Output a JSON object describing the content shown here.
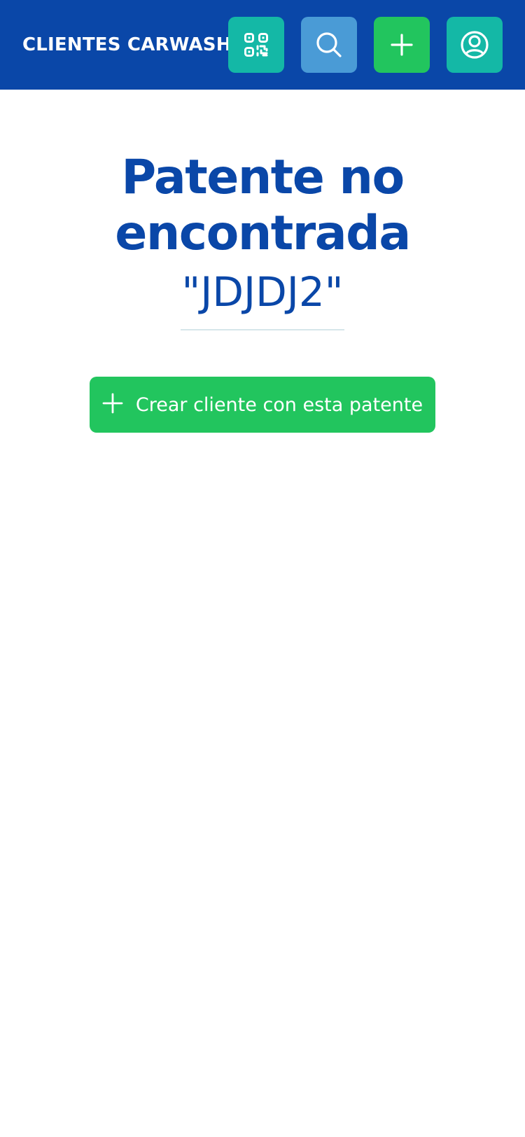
{
  "header": {
    "title": "CLIENTES CARWASH",
    "buttons": [
      {
        "icon": "qr-code-icon",
        "color": "#14b8a6"
      },
      {
        "icon": "search-icon",
        "color": "#4a9bd6"
      },
      {
        "icon": "plus-icon",
        "color": "#22c55e"
      },
      {
        "icon": "user-circle-icon",
        "color": "#14b8a6"
      }
    ],
    "background": "#0a47a8"
  },
  "main": {
    "title": "Patente no encontrada",
    "plate": "\"JDJDJ2\"",
    "create_button": {
      "label": "Crear cliente con esta patente",
      "icon": "plus-icon",
      "color": "#22c55e"
    }
  },
  "colors": {
    "primary": "#0a47a8",
    "accent_green": "#22c55e",
    "accent_teal": "#14b8a6",
    "accent_blue": "#4a9bd6"
  }
}
